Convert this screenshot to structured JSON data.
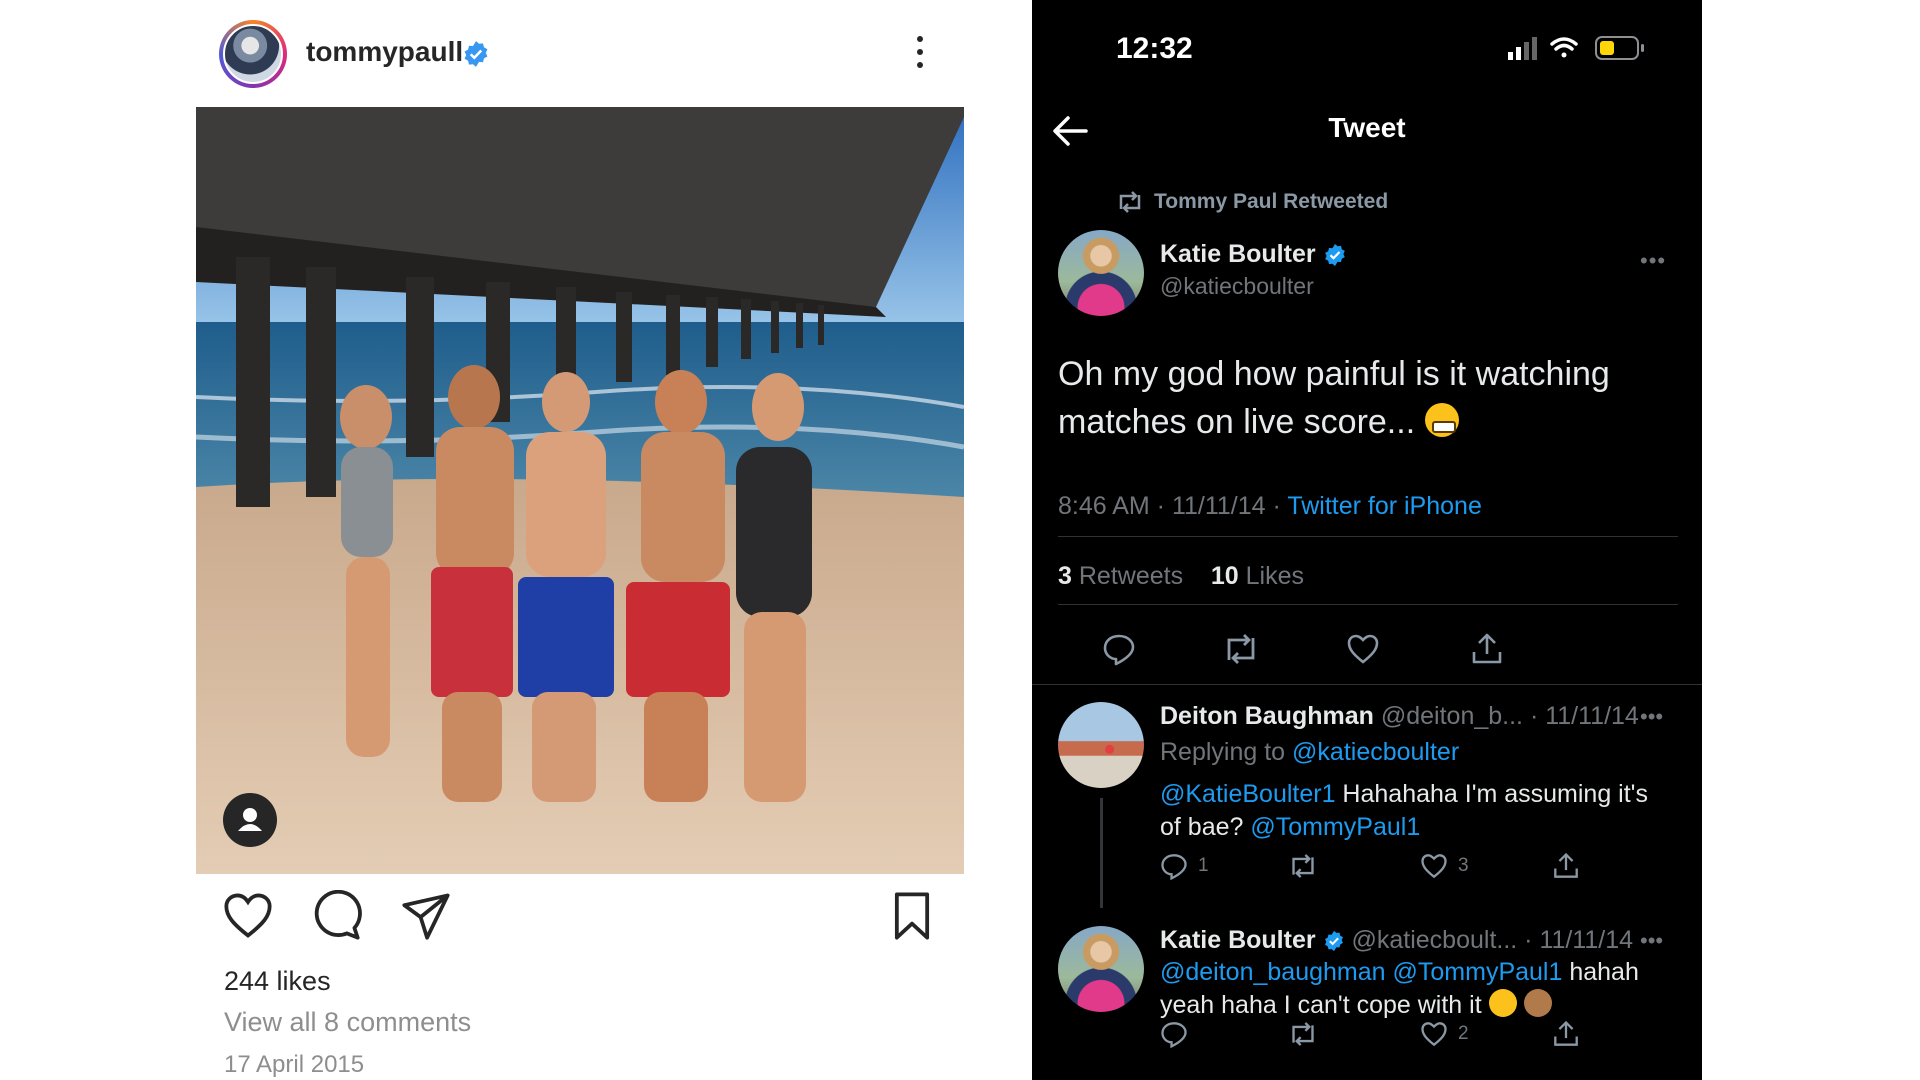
{
  "instagram": {
    "username": "tommypaull",
    "likes": "244 likes",
    "view_comments": "View all 8 comments",
    "date": "17 April 2015"
  },
  "twitter": {
    "status_time": "12:32",
    "nav_title": "Tweet",
    "retweeted_by": "Tommy Paul Retweeted",
    "main": {
      "name": "Katie Boulter",
      "handle": "@katiecboulter",
      "text": "Oh my god how painful is it watching matches on live score...",
      "time": "8:46 AM · 11/11/14 · ",
      "source": "Twitter for iPhone",
      "retweets_count": "3",
      "retweets_label": "Retweets",
      "likes_count": "10",
      "likes_label": "Likes"
    },
    "replies": [
      {
        "name": "Deiton Baughman",
        "handle_date": "@deiton_b... · 11/11/14",
        "replying_label": "Replying to ",
        "replying_to": "@katiecboulter",
        "mention1": "@KatieBoulter1",
        "text_mid": " Hahahaha I'm assuming it's of bae? ",
        "mention2": "@TommyPaul1",
        "reply_count": "1",
        "like_count": "3"
      },
      {
        "name": "Katie Boulter",
        "handle_date": "@katiecboult... · 11/11/14",
        "mention1": "@deiton_baughman",
        "mention2": "@TommyPaul1",
        "text_end": " hahah yeah haha I can't cope with it",
        "like_count": "2"
      }
    ]
  },
  "colors": {
    "twitter_link": "#1d9bf0",
    "verified": "#1d9bf0",
    "twitter_bg": "#000000",
    "muted": "#71767b"
  },
  "icons": [
    "verified-badge-icon",
    "more-vertical-icon",
    "person-tag-icon",
    "heart-icon",
    "comment-icon",
    "share-paper-plane-icon",
    "bookmark-icon",
    "signal-icon",
    "wifi-icon",
    "battery-icon",
    "back-arrow-icon",
    "retweet-icon",
    "reply-icon",
    "share-upload-icon",
    "grimacing-face-emoji",
    "flushed-face-emoji",
    "see-no-evil-monkey-emoji"
  ]
}
